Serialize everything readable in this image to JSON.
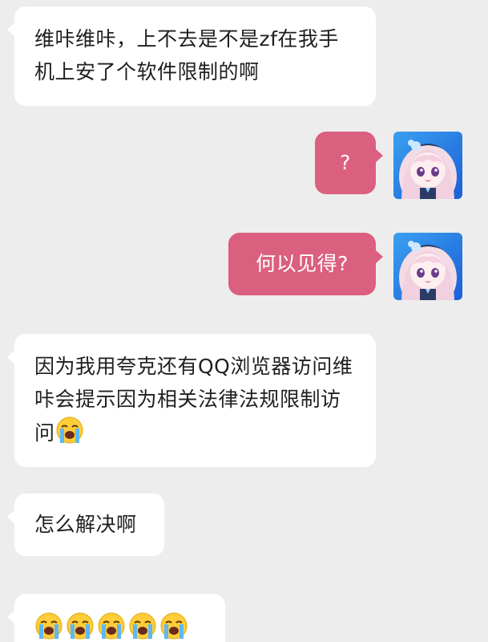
{
  "messages": [
    {
      "side": "left",
      "text": "维咔维咔，上不去是不是zf在我手机上安了个软件限制的啊"
    },
    {
      "side": "right",
      "text": "?"
    },
    {
      "side": "right",
      "text": "何以见得?"
    },
    {
      "side": "left",
      "text": "因为我用夸克还有QQ浏览器访问维咔会提示因为相关法律法规限制访问",
      "trailing_emoji": "loudly-crying-face"
    },
    {
      "side": "left",
      "text": "怎么解决啊"
    },
    {
      "side": "left",
      "text": "",
      "emoji_count": 5,
      "emoji": "loudly-crying-face"
    }
  ],
  "colors": {
    "background": "#ededed",
    "left_bubble": "#ffffff",
    "right_bubble": "#db5f7f"
  },
  "avatar": "anime-girl-avatar"
}
